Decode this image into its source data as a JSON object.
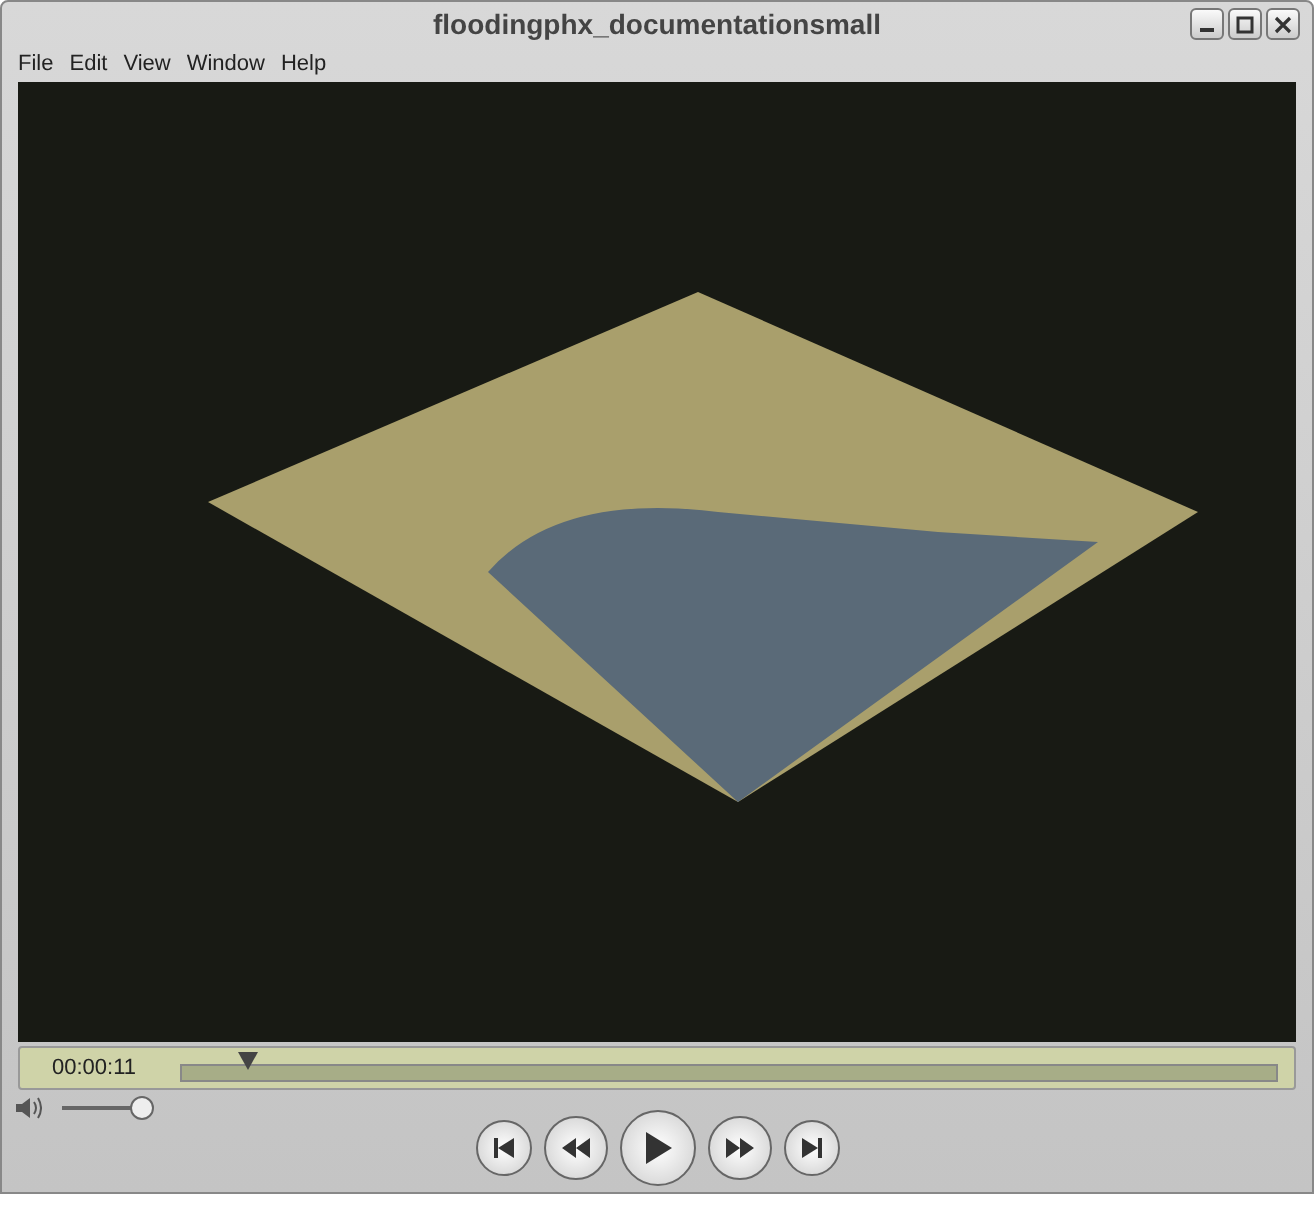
{
  "window": {
    "title": "floodingphx_documentationsmall"
  },
  "menu": [
    "File",
    "Edit",
    "View",
    "Window",
    "Help"
  ],
  "timeline": {
    "time": "00:00:11",
    "level": 0.062
  },
  "volume": {
    "level": 1.0
  }
}
